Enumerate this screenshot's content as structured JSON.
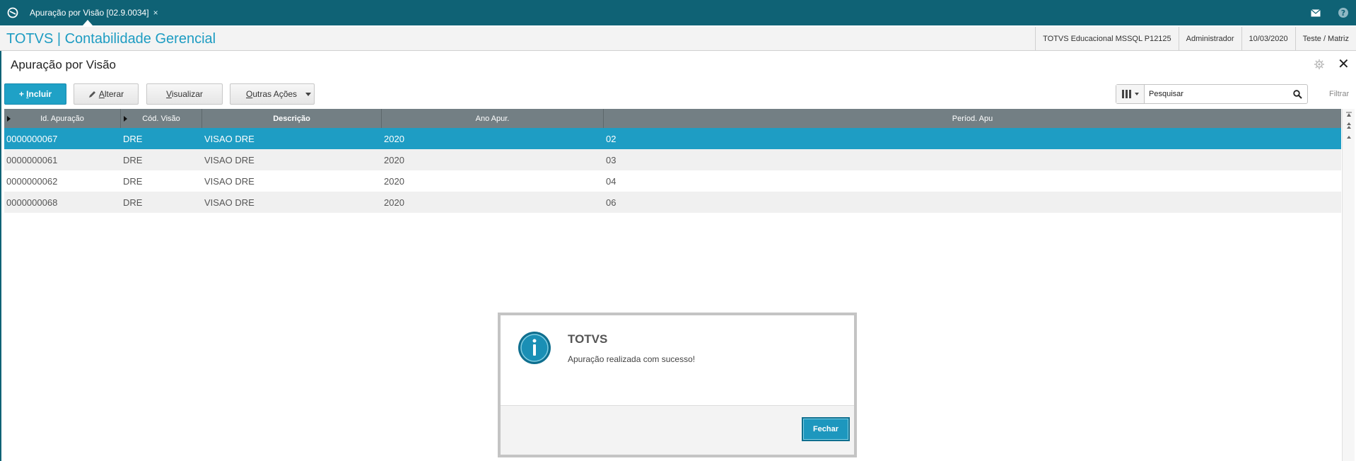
{
  "topbar": {
    "tab_title": "Apuração por Visão [02.9.0034]",
    "tab_close": "×"
  },
  "header": {
    "brand": "TOTVS | Contabilidade Gerencial",
    "environment": "TOTVS Educacional MSSQL P12125",
    "user": "Administrador",
    "date": "10/03/2020",
    "branch": "Teste / Matriz"
  },
  "page": {
    "title": "Apuração por Visão",
    "close": "✕"
  },
  "toolbar": {
    "incluir_prefix": "+ ",
    "incluir_u": "I",
    "incluir_rest": "ncluir",
    "alterar_u": "A",
    "alterar_rest": "lterar",
    "visualizar_u": "V",
    "visualizar_rest": "isualizar",
    "outras_u": "O",
    "outras_rest": "utras Ações"
  },
  "search": {
    "value": "Pesquisar",
    "filter_label": "Filtrar"
  },
  "grid": {
    "columns": [
      "Id. Apuração",
      "Cód. Visão",
      "Descrição",
      "Ano Apur.",
      "Períod. Apu"
    ],
    "rows": [
      [
        "0000000067",
        "DRE",
        "VISAO DRE",
        "2020",
        "02"
      ],
      [
        "0000000061",
        "DRE",
        "VISAO DRE",
        "2020",
        "03"
      ],
      [
        "0000000062",
        "DRE",
        "VISAO DRE",
        "2020",
        "04"
      ],
      [
        "0000000068",
        "DRE",
        "VISAO DRE",
        "2020",
        "06"
      ]
    ]
  },
  "dialog": {
    "title": "TOTVS",
    "message": "Apuração realizada com sucesso!",
    "button": "Fechar"
  },
  "colors": {
    "topbar": "#0f6275",
    "accent": "#1fa1c6",
    "selected_row": "#1e9dc4",
    "grid_header": "#737f84"
  },
  "icons": [
    "totvs-logo-icon",
    "mail-icon",
    "help-icon",
    "gear-icon",
    "columns-icon",
    "search-icon",
    "info-icon"
  ]
}
